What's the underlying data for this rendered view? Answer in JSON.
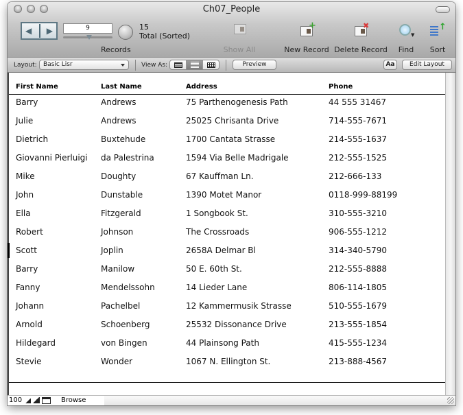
{
  "window": {
    "title": "Ch07_People"
  },
  "toolbar": {
    "current_record": "9",
    "total_count": "15",
    "total_label": "Total (Sorted)",
    "records_label": "Records",
    "slider_position_fraction": 0.6,
    "show_all_label": "Show All",
    "new_record_label": "New Record",
    "delete_record_label": "Delete Record",
    "find_label": "Find",
    "sort_label": "Sort"
  },
  "layout_bar": {
    "layout_label": "Layout:",
    "layout_value": "Basic Lisr",
    "view_as_label": "View As:",
    "view_modes": [
      "form",
      "list",
      "table"
    ],
    "active_view": "list",
    "preview_label": "Preview",
    "text_format_label": "Aa",
    "edit_layout_label": "Edit Layout"
  },
  "table": {
    "columns": [
      "First Name",
      "Last Name",
      "Address",
      "Phone"
    ],
    "rows": [
      [
        "Barry",
        "Andrews",
        "75 Parthenogenesis Path",
        "44 555 31467"
      ],
      [
        "Julie",
        "Andrews",
        "25025 Chrisanta Drive",
        "714-555-7671"
      ],
      [
        "Dietrich",
        "Buxtehude",
        "1700 Cantata Strasse",
        "214-555-1637"
      ],
      [
        "Giovanni Pierluigi",
        "da Palestrina",
        "1594 Via Belle Madrigale",
        "212-555-1525"
      ],
      [
        "Mike",
        "Doughty",
        "67 Kauffman Ln.",
        "212-666-133"
      ],
      [
        "John",
        "Dunstable",
        "1390 Motet Manor",
        "0118-999-88199"
      ],
      [
        "Ella",
        "Fitzgerald",
        "1 Songbook St.",
        "310-555-3210"
      ],
      [
        "Robert",
        "Johnson",
        "The Crossroads",
        "906-555-1212"
      ],
      [
        "Scott",
        "Joplin",
        "2658A Delmar Bl",
        "314-340-5790"
      ],
      [
        "Barry",
        "Manilow",
        "50 E. 60th St.",
        "212-555-8888"
      ],
      [
        "Fanny",
        "Mendelssohn",
        "14 Lieder Lane",
        "806-114-1805"
      ],
      [
        "Johann",
        "Pachelbel",
        "12 Kammermusik Strasse",
        "510-555-1679"
      ],
      [
        "Arnold",
        "Schoenberg",
        "25532 Dissonance Drive",
        "213-555-1854"
      ],
      [
        "Hildegard",
        "von Bingen",
        "44 Plainsong Path",
        "415-555-1234"
      ],
      [
        "Stevie",
        "Wonder",
        "1067 N. Ellington St.",
        "213-888-4567"
      ]
    ],
    "active_row_index": 8
  },
  "bottom_bar": {
    "zoom_level": "100",
    "mode": "Browse"
  }
}
